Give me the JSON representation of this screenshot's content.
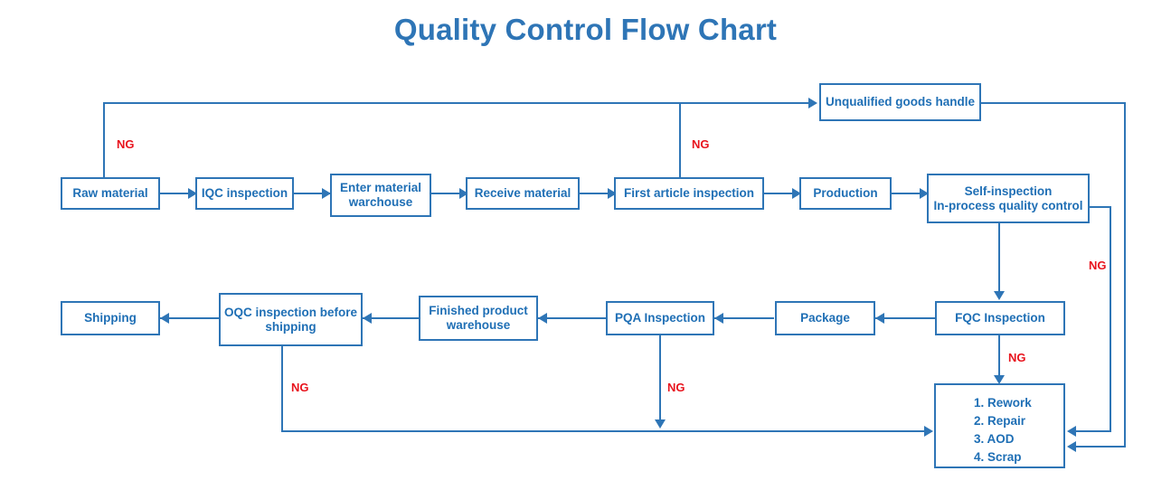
{
  "title": "Quality Control Flow Chart",
  "colors": {
    "box_border": "#2E75B6",
    "box_text": "#1F6FB5",
    "title": "#2E75B6",
    "connector": "#2E75B6",
    "ng_label": "#E8131D",
    "background": "#FFFFFF"
  },
  "nodes": {
    "raw_material": "Raw material",
    "iqc_inspection": "IQC inspection",
    "enter_material_warehouse": "Enter material\nwarchouse",
    "receive_material": "Receive material",
    "first_article_inspection": "First article inspection",
    "production": "Production",
    "self_inspection": "Self-inspection\nIn-process quality control",
    "unqualified_goods_handle": "Unqualified goods handle",
    "fqc_inspection": "FQC Inspection",
    "package": "Package",
    "pqa_inspection": "PQA Inspection",
    "finished_product_warehouse": "Finished product\nwarehouse",
    "oqc_inspection": "OQC inspection before\nshipping",
    "shipping": "Shipping",
    "rework_options": "1. Rework\n2. Repair\n3. AOD\n4. Scrap"
  },
  "ng_labels": {
    "iqc": "NG",
    "first_article": "NG",
    "self_inspection": "NG",
    "fqc": "NG",
    "pqa": "NG",
    "oqc": "NG"
  },
  "chart_data": {
    "type": "flowchart",
    "title": "Quality Control Flow Chart",
    "nodes": [
      {
        "id": "raw_material",
        "label": "Raw material",
        "row": 1
      },
      {
        "id": "iqc_inspection",
        "label": "IQC inspection",
        "row": 1
      },
      {
        "id": "enter_material_warehouse",
        "label": "Enter material warchouse",
        "row": 1
      },
      {
        "id": "receive_material",
        "label": "Receive material",
        "row": 1
      },
      {
        "id": "first_article_inspection",
        "label": "First article inspection",
        "row": 1
      },
      {
        "id": "production",
        "label": "Production",
        "row": 1
      },
      {
        "id": "self_inspection",
        "label": "Self-inspection In-process quality control",
        "row": 1
      },
      {
        "id": "unqualified_goods_handle",
        "label": "Unqualified goods handle",
        "row": 0
      },
      {
        "id": "fqc_inspection",
        "label": "FQC Inspection",
        "row": 2
      },
      {
        "id": "package",
        "label": "Package",
        "row": 2
      },
      {
        "id": "pqa_inspection",
        "label": "PQA Inspection",
        "row": 2
      },
      {
        "id": "finished_product_warehouse",
        "label": "Finished product warehouse",
        "row": 2
      },
      {
        "id": "oqc_inspection",
        "label": "OQC inspection before shipping",
        "row": 2
      },
      {
        "id": "shipping",
        "label": "Shipping",
        "row": 2
      },
      {
        "id": "rework_options",
        "label": "1. Rework 2. Repair 3. AOD 4. Scrap",
        "row": 3
      }
    ],
    "edges": [
      {
        "from": "raw_material",
        "to": "iqc_inspection",
        "label": ""
      },
      {
        "from": "iqc_inspection",
        "to": "enter_material_warehouse",
        "label": ""
      },
      {
        "from": "enter_material_warehouse",
        "to": "receive_material",
        "label": ""
      },
      {
        "from": "receive_material",
        "to": "first_article_inspection",
        "label": ""
      },
      {
        "from": "first_article_inspection",
        "to": "production",
        "label": ""
      },
      {
        "from": "production",
        "to": "self_inspection",
        "label": ""
      },
      {
        "from": "iqc_inspection",
        "to": "unqualified_goods_handle",
        "label": "NG"
      },
      {
        "from": "first_article_inspection",
        "to": "unqualified_goods_handle",
        "label": "NG"
      },
      {
        "from": "unqualified_goods_handle",
        "to": "rework_options",
        "label": ""
      },
      {
        "from": "self_inspection",
        "to": "fqc_inspection",
        "label": ""
      },
      {
        "from": "self_inspection",
        "to": "rework_options",
        "label": "NG"
      },
      {
        "from": "fqc_inspection",
        "to": "package",
        "label": ""
      },
      {
        "from": "fqc_inspection",
        "to": "rework_options",
        "label": "NG"
      },
      {
        "from": "package",
        "to": "pqa_inspection",
        "label": ""
      },
      {
        "from": "pqa_inspection",
        "to": "finished_product_warehouse",
        "label": ""
      },
      {
        "from": "pqa_inspection",
        "to": "rework_options",
        "label": "NG"
      },
      {
        "from": "finished_product_warehouse",
        "to": "oqc_inspection",
        "label": ""
      },
      {
        "from": "oqc_inspection",
        "to": "shipping",
        "label": ""
      },
      {
        "from": "oqc_inspection",
        "to": "rework_options",
        "label": "NG"
      }
    ]
  }
}
